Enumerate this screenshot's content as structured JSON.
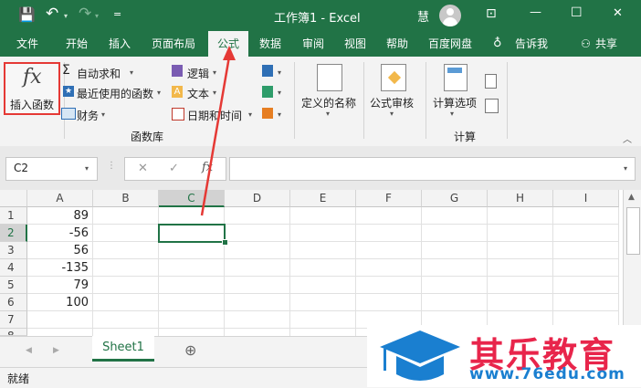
{
  "window": {
    "title": "工作簿1  -  Excel",
    "user_initial": "慧",
    "buttons": {
      "minimize": "—",
      "maximize": "☐",
      "close": "✕",
      "ribbon_display": "⊡"
    }
  },
  "quick_access": {
    "save": "💾",
    "undo": "↶",
    "redo": "↷",
    "customize": "="
  },
  "tabs": [
    "文件",
    "开始",
    "插入",
    "页面布局",
    "公式",
    "数据",
    "审阅",
    "视图",
    "帮助",
    "百度网盘",
    "告诉我",
    "共享"
  ],
  "active_tab": "公式",
  "ribbon": {
    "insert_function": {
      "icon_text": "fx",
      "label": "插入函数"
    },
    "library": {
      "autosum": "自动求和",
      "recent": "最近使用的函数",
      "financial": "财务",
      "logical": "逻辑",
      "text": "文本",
      "datetime": "日期和时间",
      "group_label": "函数库"
    },
    "defined_names": {
      "label": "定义的名称"
    },
    "auditing": {
      "label": "公式审核"
    },
    "calculation": {
      "options_label": "计算选项",
      "group_label": "计算"
    }
  },
  "formula_bar": {
    "name_box": "C2",
    "fx": "fx",
    "cancel": "✕",
    "enter": "✓",
    "value": ""
  },
  "columns": [
    "A",
    "B",
    "C",
    "D",
    "E",
    "F",
    "G",
    "H",
    "I"
  ],
  "rows": [
    "1",
    "2",
    "3",
    "4",
    "5",
    "6",
    "7",
    "8"
  ],
  "cells_a": [
    "89",
    "-56",
    "56",
    "-135",
    "79",
    "100",
    "",
    ""
  ],
  "selected_cell": "C2",
  "sheets": [
    "Sheet1"
  ],
  "add_sheet": "⊕",
  "status": "就绪",
  "watermark": {
    "brand": "其乐教育",
    "url": "www.76edu.com"
  }
}
